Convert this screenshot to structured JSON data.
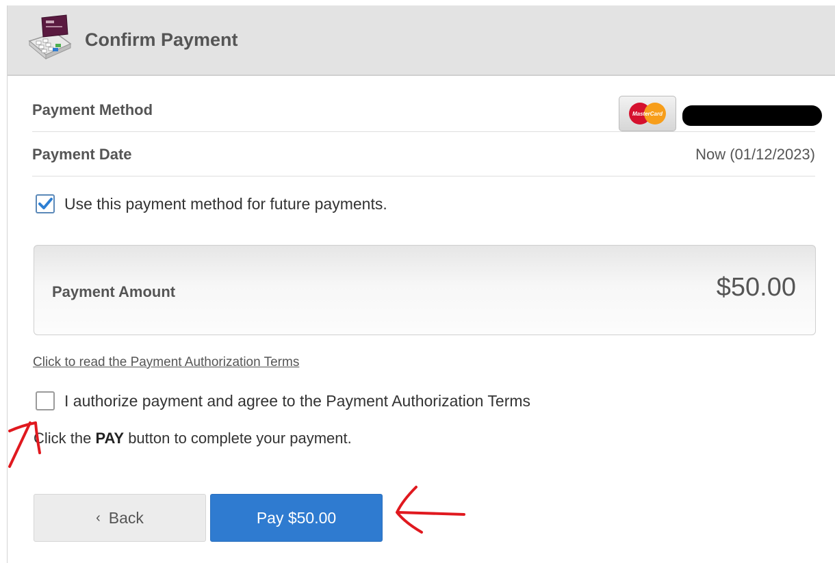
{
  "header": {
    "title": "Confirm Payment",
    "icon": "payment-terminal-icon"
  },
  "payment_method": {
    "label": "Payment Method",
    "card_brand_text": "MasterCard",
    "card_icon": "mastercard-icon",
    "account_display": "redacted"
  },
  "payment_date": {
    "label": "Payment Date",
    "value": "Now (01/12/2023)"
  },
  "save_method": {
    "checked": true,
    "label": "Use this payment method for future payments."
  },
  "amount": {
    "label": "Payment Amount",
    "value": "$50.00"
  },
  "terms_link": "Click to read the Payment Authorization Terms",
  "authorize": {
    "checked": false,
    "label": "I authorize payment and agree to the Payment Authorization Terms"
  },
  "instruction": {
    "prefix": "Click the ",
    "emphasis": "PAY",
    "suffix": " button to complete your payment."
  },
  "buttons": {
    "back_label": "Back",
    "back_icon": "chevron-left-icon",
    "pay_label": "Pay $50.00"
  },
  "colors": {
    "primary": "#2f7bd0",
    "check": "#2d7fd3",
    "annotation": "#e0191f",
    "header_bg": "#e3e3e3"
  }
}
